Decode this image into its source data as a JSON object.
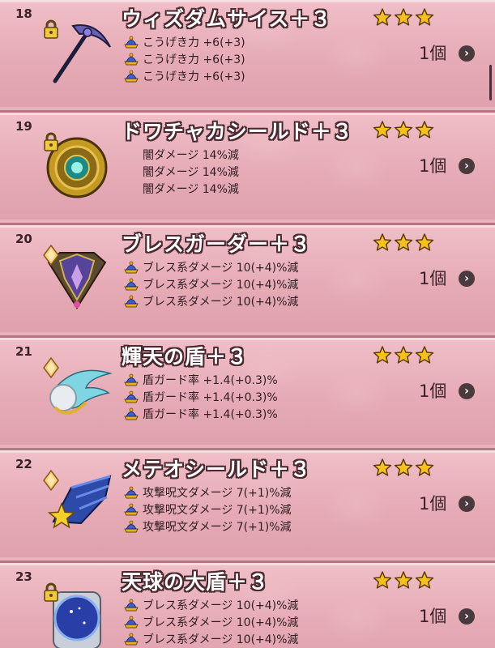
{
  "items": [
    {
      "number": "18",
      "name": "ウィズダムサイス＋３",
      "stars": 3,
      "lock": "padlock",
      "art": "scythe",
      "bullets": true,
      "stats": [
        "こうげき力 +6(+3)",
        "こうげき力 +6(+3)",
        "こうげき力 +6(+3)"
      ],
      "count": "1個"
    },
    {
      "number": "19",
      "name": "ドワチャカシールド＋３",
      "stars": 3,
      "lock": "padlock",
      "art": "round-shield",
      "bullets": false,
      "stats": [
        "闇ダメージ 14%減",
        "闇ダメージ 14%減",
        "闇ダメージ 14%減"
      ],
      "count": "1個"
    },
    {
      "number": "20",
      "name": "ブレスガーダー＋３",
      "stars": 3,
      "lock": "diamond",
      "art": "spiked-shield",
      "bullets": true,
      "stats": [
        "ブレス系ダメージ 10(+4)%減",
        "ブレス系ダメージ 10(+4)%減",
        "ブレス系ダメージ 10(+4)%減"
      ],
      "count": "1個"
    },
    {
      "number": "21",
      "name": "輝天の盾＋３",
      "stars": 3,
      "lock": "diamond",
      "art": "wing-shield",
      "bullets": true,
      "stats": [
        "盾ガード率 +1.4(+0.3)%",
        "盾ガード率 +1.4(+0.3)%",
        "盾ガード率 +1.4(+0.3)%"
      ],
      "count": "1個"
    },
    {
      "number": "22",
      "name": "メテオシールド＋３",
      "stars": 3,
      "lock": "diamond",
      "art": "meteor-shield",
      "bullets": true,
      "stats": [
        "攻撃呪文ダメージ 7(+1)%減",
        "攻撃呪文ダメージ 7(+1)%減",
        "攻撃呪文ダメージ 7(+1)%減"
      ],
      "count": "1個"
    },
    {
      "number": "23",
      "name": "天球の大盾＋３",
      "stars": 3,
      "lock": "padlock",
      "art": "orb-shield",
      "bullets": true,
      "stats": [
        "ブレス系ダメージ 10(+4)%減",
        "ブレス系ダメージ 10(+4)%減",
        "ブレス系ダメージ 10(+4)%減"
      ],
      "count": "1個"
    }
  ],
  "icons": {
    "star": "star-icon",
    "bullet": "blue-gem-bullet-icon",
    "detail": "chevron-right-icon",
    "detail_glyph": "›"
  },
  "colors": {
    "star_fill": "#f7c11b",
    "name_outline": "#4a2a30",
    "panel": "#e9b3bd"
  }
}
